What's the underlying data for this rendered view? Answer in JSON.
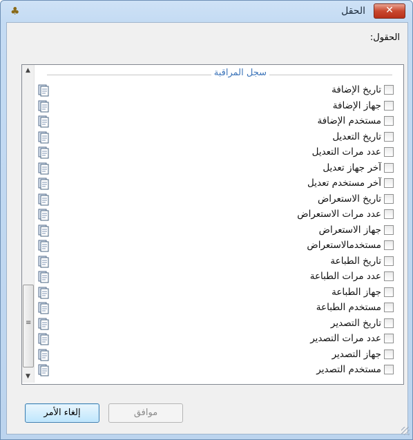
{
  "window": {
    "title": "الحقل",
    "close_glyph": "✕"
  },
  "fields_label": "الحقول:",
  "group_label": "سجل المراقبة",
  "items": [
    "تاريخ الإضافة",
    "جهاز الإضافة",
    "مستخدم الإضافة",
    "تاريخ التعديل",
    "عدد مرات التعديل",
    "آخر جهاز تعديل",
    "آخر مستخدم تعديل",
    "تاريخ الاستعراض",
    "عدد مرات الاستعراض",
    "جهاز الاستعراض",
    "مستخدمالاستعراض",
    "تاريخ الطباعة",
    "عدد مرات الطباعة",
    "جهاز الطباعة",
    "مستخدم الطباعة",
    "تاريخ التصدير",
    "عدد مرات التصدير",
    "جهاز التصدير",
    "مستخدم التصدير"
  ],
  "buttons": {
    "ok": "موافق",
    "cancel": "إلغاء الأمر"
  },
  "icons": {
    "app": "app-logo-icon",
    "close": "close-icon",
    "doc": "document-stack-icon"
  },
  "colors": {
    "group_label": "#3c74b9",
    "close_button": "#c9482f"
  }
}
